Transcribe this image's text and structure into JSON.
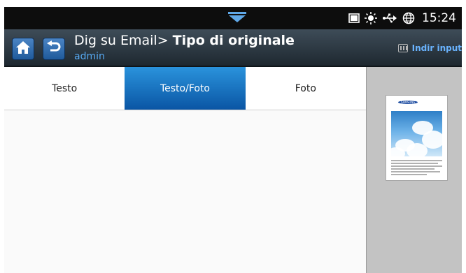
{
  "status_bar": {
    "time": "15:24",
    "icons": [
      "pulldown-arrow-icon",
      "screen-icon",
      "brightness-icon",
      "usb-icon",
      "globe-icon"
    ]
  },
  "header": {
    "title_prefix": "Dig su Email> ",
    "title_main": "Tipo di originale",
    "subtitle": "admin",
    "hide_input_label": "Indir input",
    "buttons": [
      "home-icon",
      "back-icon"
    ]
  },
  "tabs": [
    {
      "label": "Testo",
      "selected": false
    },
    {
      "label": "Testo/Foto",
      "selected": true
    },
    {
      "label": "Foto",
      "selected": false
    }
  ],
  "preview": {
    "logo_text": "SAMSUNG"
  },
  "colors": {
    "selected_tab": "#0a6fc0",
    "header_bg": "#2c3640",
    "button_blue": "#2f6db0",
    "link_blue": "#6ab4ff"
  }
}
